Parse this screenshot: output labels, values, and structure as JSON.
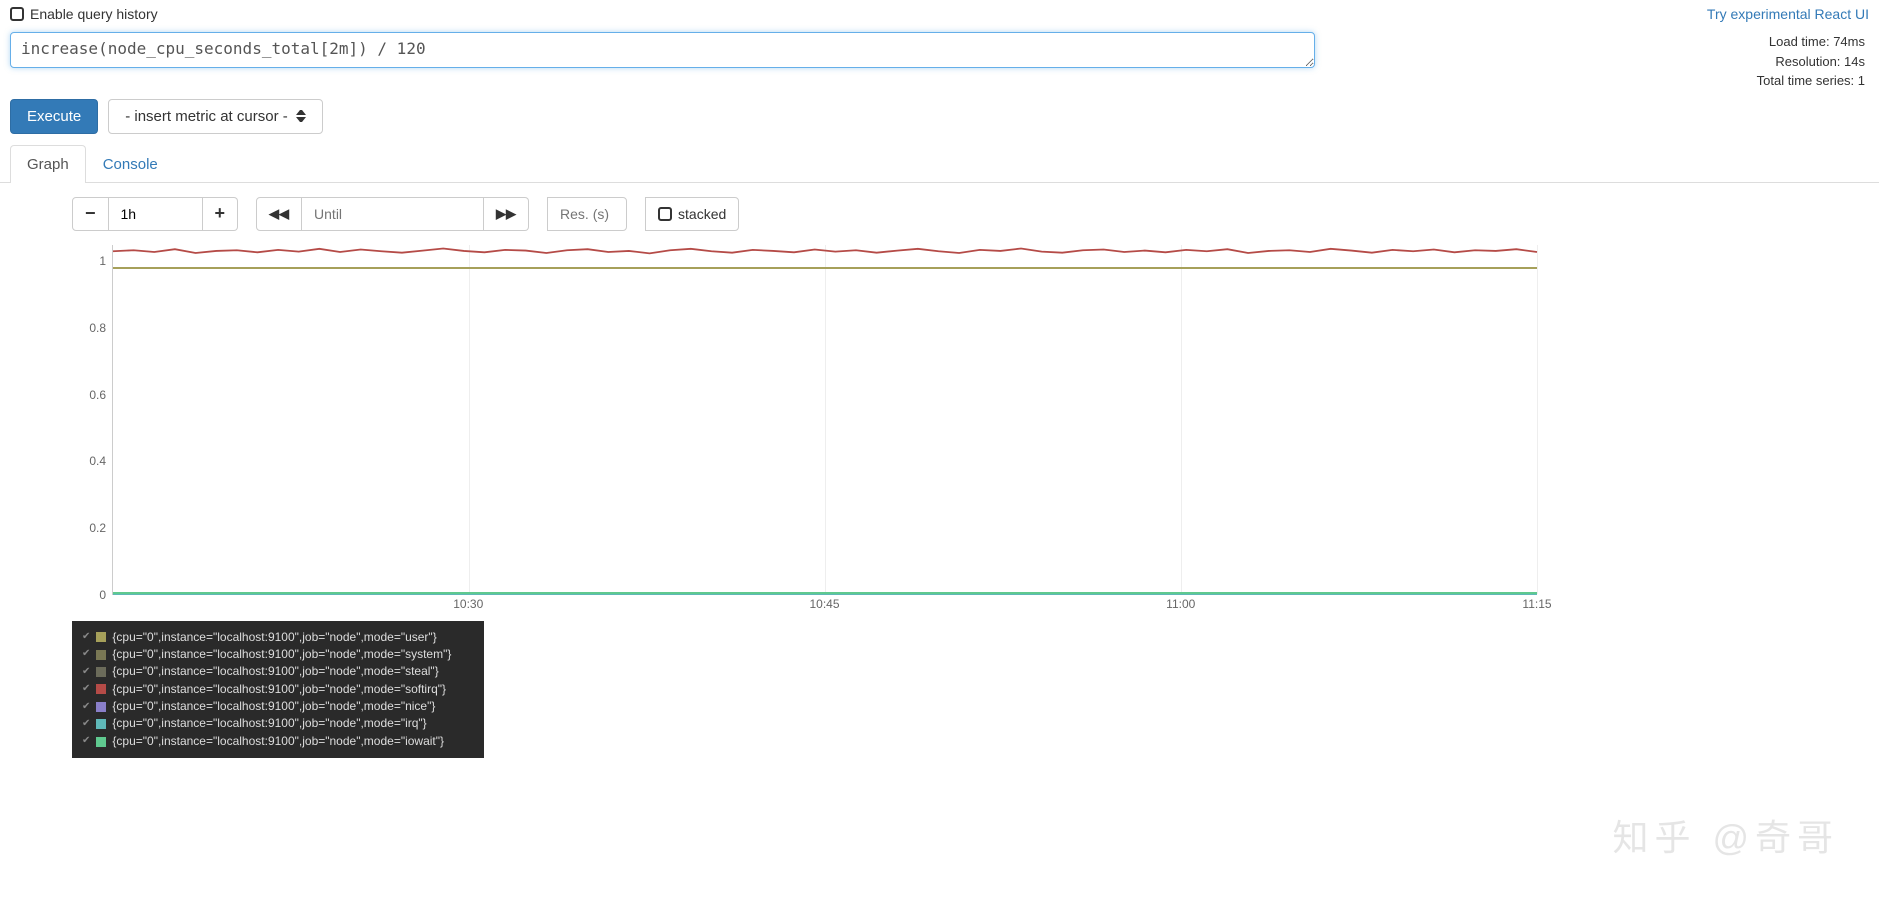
{
  "header": {
    "history_label": "Enable query history",
    "react_link": "Try experimental React UI"
  },
  "query": {
    "expression": "increase(node_cpu_seconds_total[2m]) / 120"
  },
  "stats": {
    "load_time": "Load time: 74ms",
    "resolution": "Resolution: 14s",
    "total_series": "Total time series: 1"
  },
  "actions": {
    "execute": "Execute",
    "metric_dropdown": "- insert metric at cursor -"
  },
  "tabs": {
    "graph": "Graph",
    "console": "Console"
  },
  "controls": {
    "range": "1h",
    "until_placeholder": "Until",
    "res_placeholder": "Res. (s)",
    "stacked": "stacked"
  },
  "chart_data": {
    "type": "line",
    "ylim": [
      0,
      1.05
    ],
    "y_ticks": [
      0,
      0.2,
      0.4,
      0.6,
      0.8,
      1
    ],
    "x_ticks": [
      "10:30",
      "10:45",
      "11:00",
      "11:15"
    ],
    "x_tick_positions_pct": [
      25,
      50,
      75,
      100
    ],
    "series": [
      {
        "name": "user",
        "color": "#a6a05a",
        "value": 0.98,
        "flat": true
      },
      {
        "name": "system",
        "color": "#7a7854",
        "value": 0.005,
        "flat": true
      },
      {
        "name": "steal",
        "color": "#6b6b5a",
        "value": 0.003,
        "flat": true
      },
      {
        "name": "softirq",
        "color": "#b54b47",
        "value": 0.985,
        "flat": false,
        "points_pct": [
          98.2,
          98.5,
          98.0,
          98.8,
          97.7,
          98.3,
          98.5,
          97.9,
          98.6,
          98.1,
          98.9,
          98.0,
          98.7,
          98.2,
          97.8,
          98.4,
          99.0,
          98.3,
          97.9,
          98.6,
          98.4,
          97.7,
          98.5,
          98.8,
          98.0,
          98.3,
          97.6,
          98.5,
          98.9,
          98.2,
          97.8,
          98.6,
          98.3,
          97.9,
          98.7,
          98.1,
          98.5,
          97.8,
          98.4,
          98.9,
          98.2,
          97.7,
          98.6,
          98.3,
          99.0,
          98.1,
          97.8,
          98.5,
          98.7,
          98.0,
          98.4,
          97.9,
          98.6,
          98.2,
          98.8,
          97.7,
          98.3,
          98.5,
          98.0,
          98.9,
          98.4,
          97.8,
          98.6,
          98.2,
          98.7,
          97.9,
          98.5,
          98.3,
          98.8,
          98.0
        ]
      },
      {
        "name": "nice",
        "color": "#8a7fc9",
        "value": 0.002,
        "flat": true
      },
      {
        "name": "irq",
        "color": "#5fb8b8",
        "value": 0.001,
        "flat": true
      },
      {
        "name": "iowait",
        "color": "#5fc98f",
        "value": 0.004,
        "flat": true
      }
    ]
  },
  "legend": {
    "rows": [
      {
        "color": "#a6a05a",
        "text": "{cpu=\"0\",instance=\"localhost:9100\",job=\"node\",mode=\"user\"}"
      },
      {
        "color": "#7a7854",
        "text": "{cpu=\"0\",instance=\"localhost:9100\",job=\"node\",mode=\"system\"}"
      },
      {
        "color": "#6b6b5a",
        "text": "{cpu=\"0\",instance=\"localhost:9100\",job=\"node\",mode=\"steal\"}"
      },
      {
        "color": "#b54b47",
        "text": "{cpu=\"0\",instance=\"localhost:9100\",job=\"node\",mode=\"softirq\"}"
      },
      {
        "color": "#8a7fc9",
        "text": "{cpu=\"0\",instance=\"localhost:9100\",job=\"node\",mode=\"nice\"}"
      },
      {
        "color": "#5fb8b8",
        "text": "{cpu=\"0\",instance=\"localhost:9100\",job=\"node\",mode=\"irq\"}"
      },
      {
        "color": "#5fc98f",
        "text": "{cpu=\"0\",instance=\"localhost:9100\",job=\"node\",mode=\"iowait\"}"
      }
    ]
  },
  "watermark": "知乎 @奇哥"
}
